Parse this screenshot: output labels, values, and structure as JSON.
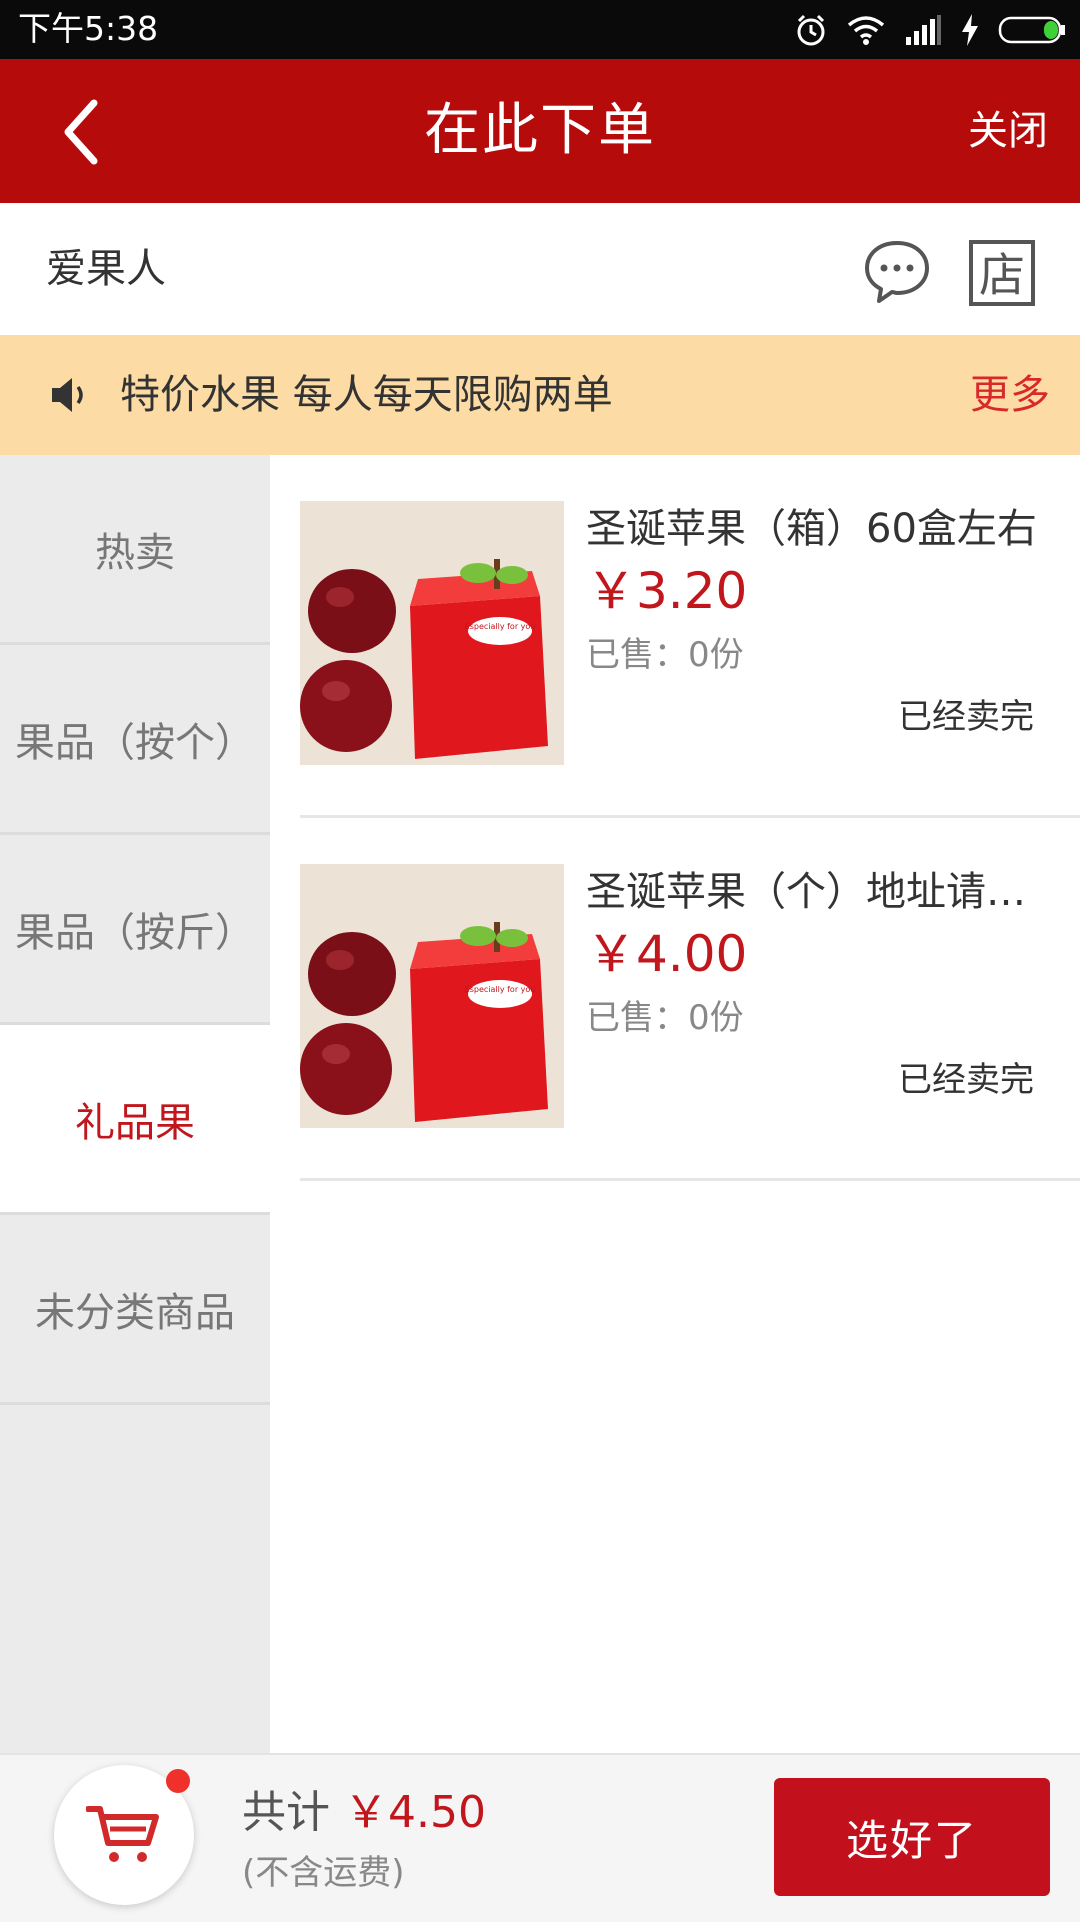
{
  "status_bar": {
    "time": "下午5:38"
  },
  "header": {
    "title": "在此下单",
    "close_label": "关闭"
  },
  "shop": {
    "name": "爱果人"
  },
  "notice": {
    "text": "特价水果 每人每天限购两单",
    "more_label": "更多"
  },
  "sidebar": {
    "categories": [
      {
        "label": "热卖",
        "active": false
      },
      {
        "label": "果品（按个）",
        "active": false
      },
      {
        "label": "果品（按斤）",
        "active": false
      },
      {
        "label": "礼品果",
        "active": true
      },
      {
        "label": "未分类商品",
        "active": false
      }
    ]
  },
  "products": [
    {
      "name": "圣诞苹果（箱）60盒左右",
      "price": "￥3.20",
      "sold": "已售：0份",
      "status": "已经卖完",
      "box_text": "Especially for you"
    },
    {
      "name": "圣诞苹果（个）地址请备注",
      "price": "￥4.00",
      "sold": "已售：0份",
      "status": "已经卖完",
      "box_text": "Especially for you"
    }
  ],
  "footer": {
    "total_label": "共计",
    "total_amount": "￥4.50",
    "note": "(不含运费)",
    "confirm_label": "选好了"
  },
  "colors": {
    "brand_red": "#b50b0b",
    "accent_red": "#c0161c",
    "notice_bg": "#fcdca4"
  },
  "icons": [
    "back-icon",
    "alarm-icon",
    "wifi-icon",
    "signal-icon",
    "charging-icon",
    "battery-icon",
    "chat-icon",
    "store-icon",
    "speaker-icon",
    "cart-icon"
  ]
}
